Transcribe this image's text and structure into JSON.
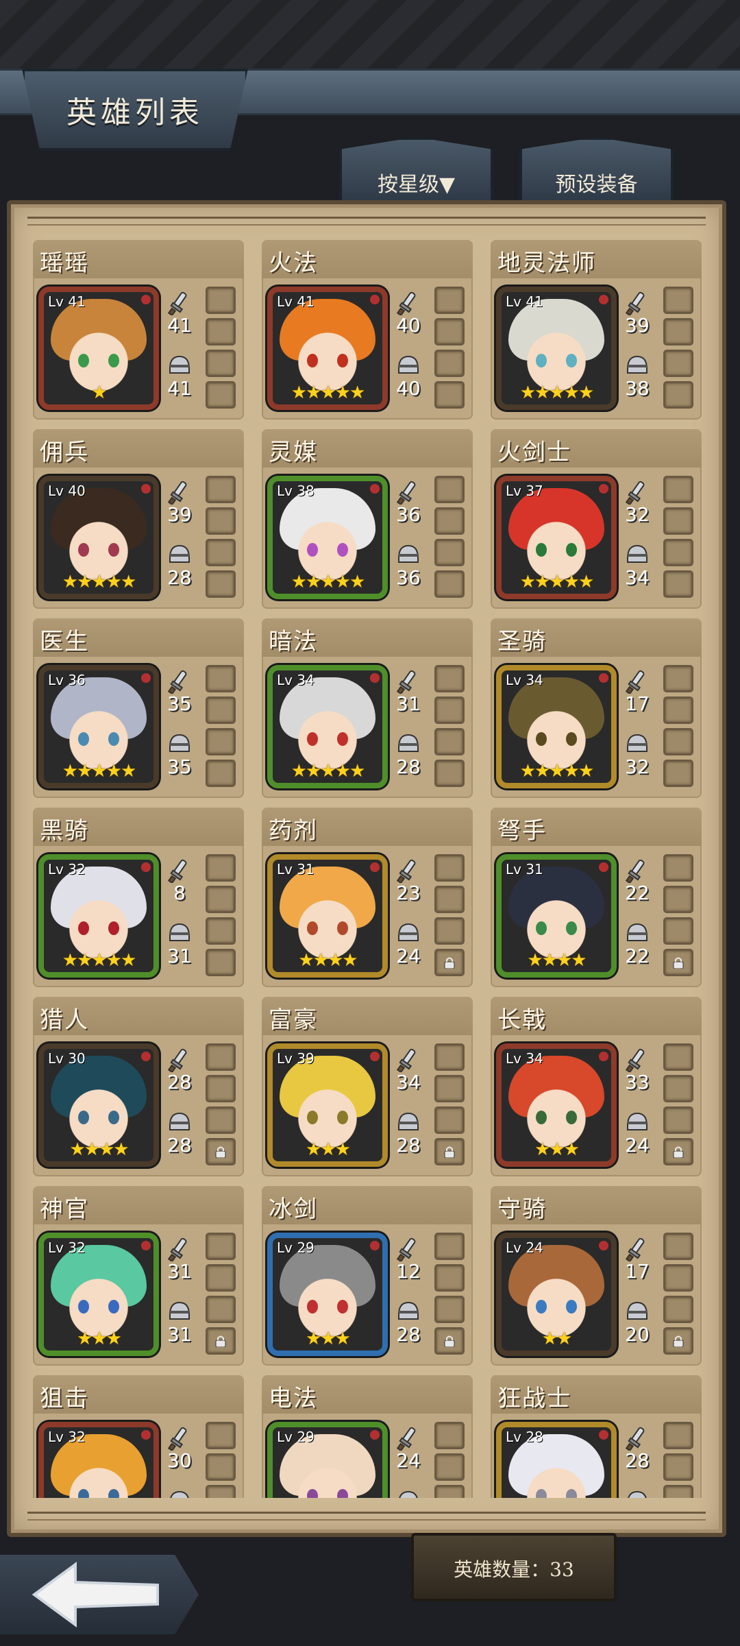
{
  "header": {
    "title": "英雄列表"
  },
  "tabs": {
    "sort_label": "按星级▼",
    "preset_label": "预设装备"
  },
  "footer": {
    "hero_count_label": "英雄数量：33"
  },
  "colors": {
    "frame_red": "#8e3a2a",
    "frame_gold": "#b18a2a",
    "frame_green": "#4f8f2a",
    "frame_blue": "#2f6fb0",
    "frame_dark": "#4a3a2a"
  },
  "heroes": [
    {
      "name": "瑶瑶",
      "level": "Lv 41",
      "attack": "41",
      "defense": "41",
      "stars": "★",
      "frame": "frame_red",
      "hair": "#c8843a",
      "eyes": "#3a9a4a",
      "locked": false
    },
    {
      "name": "火法",
      "level": "Lv 41",
      "attack": "40",
      "defense": "40",
      "stars": "★★★★★",
      "frame": "frame_red",
      "hair": "#e87a22",
      "eyes": "#c0301f",
      "locked": false
    },
    {
      "name": "地灵法师",
      "level": "Lv 41",
      "attack": "39",
      "defense": "38",
      "stars": "★★★★★",
      "frame": "frame_dark",
      "hair": "#d9d9d0",
      "eyes": "#5fb0c0",
      "locked": false
    },
    {
      "name": "佣兵",
      "level": "Lv 40",
      "attack": "39",
      "defense": "28",
      "stars": "★★★★★",
      "frame": "frame_dark",
      "hair": "#3a2a1f",
      "eyes": "#a03a50",
      "locked": false
    },
    {
      "name": "灵媒",
      "level": "Lv 38",
      "attack": "36",
      "defense": "36",
      "stars": "★★★★★",
      "frame": "frame_green",
      "hair": "#e9e9e9",
      "eyes": "#b050c0",
      "locked": false
    },
    {
      "name": "火剑士",
      "level": "Lv 37",
      "attack": "32",
      "defense": "34",
      "stars": "★★★★★",
      "frame": "frame_red",
      "hair": "#d8352a",
      "eyes": "#2a7a3a",
      "locked": false
    },
    {
      "name": "医生",
      "level": "Lv 36",
      "attack": "35",
      "defense": "35",
      "stars": "★★★★★",
      "frame": "frame_dark",
      "hair": "#b0b6c8",
      "eyes": "#4a8ab0",
      "locked": false
    },
    {
      "name": "暗法",
      "level": "Lv 34",
      "attack": "31",
      "defense": "28",
      "stars": "★★★★★",
      "frame": "frame_green",
      "hair": "#d8d8d8",
      "eyes": "#c0302a",
      "locked": false
    },
    {
      "name": "圣骑",
      "level": "Lv 34",
      "attack": "17",
      "defense": "32",
      "stars": "★★★★★",
      "frame": "frame_gold",
      "hair": "#6a5a30",
      "eyes": "#5a4a20",
      "locked": false
    },
    {
      "name": "黑骑",
      "level": "Lv 32",
      "attack": "8",
      "defense": "31",
      "stars": "★★★★★",
      "frame": "frame_green",
      "hair": "#e0e0e8",
      "eyes": "#b0202a",
      "locked": false
    },
    {
      "name": "药剂",
      "level": "Lv 31",
      "attack": "23",
      "defense": "24",
      "stars": "★★★★",
      "frame": "frame_gold",
      "hair": "#f0a848",
      "eyes": "#b04a2a",
      "locked": true
    },
    {
      "name": "弩手",
      "level": "Lv 31",
      "attack": "22",
      "defense": "22",
      "stars": "★★★★",
      "frame": "frame_green",
      "hair": "#2a3040",
      "eyes": "#3a8a4a",
      "locked": true
    },
    {
      "name": "猎人",
      "level": "Lv 30",
      "attack": "28",
      "defense": "28",
      "stars": "★★★★",
      "frame": "frame_dark",
      "hair": "#1f4a5a",
      "eyes": "#3a6a8a",
      "locked": true
    },
    {
      "name": "富豪",
      "level": "Lv 39",
      "attack": "34",
      "defense": "28",
      "stars": "★★★",
      "frame": "frame_gold",
      "hair": "#e8c840",
      "eyes": "#8a7a2a",
      "locked": true
    },
    {
      "name": "长戟",
      "level": "Lv 34",
      "attack": "33",
      "defense": "24",
      "stars": "★★★",
      "frame": "frame_red",
      "hair": "#d8482a",
      "eyes": "#3a6a3a",
      "locked": true
    },
    {
      "name": "神官",
      "level": "Lv 32",
      "attack": "31",
      "defense": "31",
      "stars": "★★★",
      "frame": "frame_green",
      "hair": "#5ac8a0",
      "eyes": "#3a6ac0",
      "locked": true
    },
    {
      "name": "冰剑",
      "level": "Lv 29",
      "attack": "12",
      "defense": "28",
      "stars": "★★★",
      "frame": "frame_blue",
      "hair": "#8a8a8a",
      "eyes": "#c03030",
      "locked": true
    },
    {
      "name": "守骑",
      "level": "Lv 24",
      "attack": "17",
      "defense": "20",
      "stars": "★★",
      "frame": "frame_dark",
      "hair": "#a8683a",
      "eyes": "#3a7ac0",
      "locked": true
    },
    {
      "name": "狙击",
      "level": "Lv 32",
      "attack": "30",
      "defense": "",
      "stars": "",
      "frame": "frame_red",
      "hair": "#e8a030",
      "eyes": "#3a6a9a",
      "locked": false
    },
    {
      "name": "电法",
      "level": "Lv 29",
      "attack": "24",
      "defense": "",
      "stars": "",
      "frame": "frame_green",
      "hair": "#f0d8c0",
      "eyes": "#8a4a9a",
      "locked": false
    },
    {
      "name": "狂战士",
      "level": "Lv 28",
      "attack": "28",
      "defense": "",
      "stars": "",
      "frame": "frame_gold",
      "hair": "#e8e8f0",
      "eyes": "#8a8a9a",
      "locked": false
    }
  ]
}
